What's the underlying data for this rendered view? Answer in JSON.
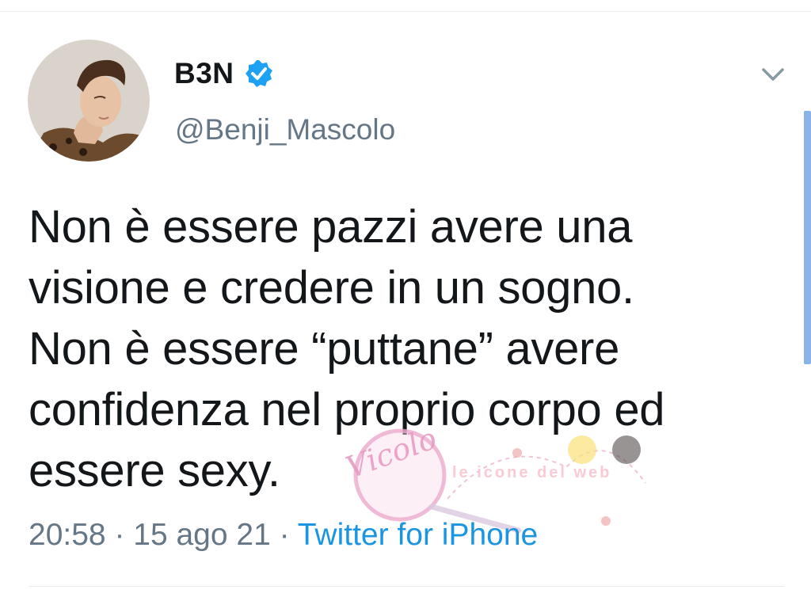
{
  "tweet": {
    "display_name": "B3N",
    "handle": "@Benji_Mascolo",
    "text_lines": [
      "Non è essere pazzi avere una",
      "visione e credere in un sogno.",
      "Non è essere “puttane” avere",
      "confidenza nel proprio corpo ed",
      "essere sexy."
    ],
    "time": "20:58",
    "separator": " · ",
    "date": "15 ago 21",
    "source": "Twitter for iPhone"
  },
  "icons": {
    "verified": "verified-badge-icon",
    "caret": "chevron-down-icon"
  },
  "watermark": {
    "line1": "Vicolo",
    "line2": "le icone del web"
  },
  "colors": {
    "text": "#14171a",
    "secondary": "#657786",
    "link": "#1b95e0",
    "verified": "#1da1f2",
    "divider": "#e6ecf0"
  }
}
